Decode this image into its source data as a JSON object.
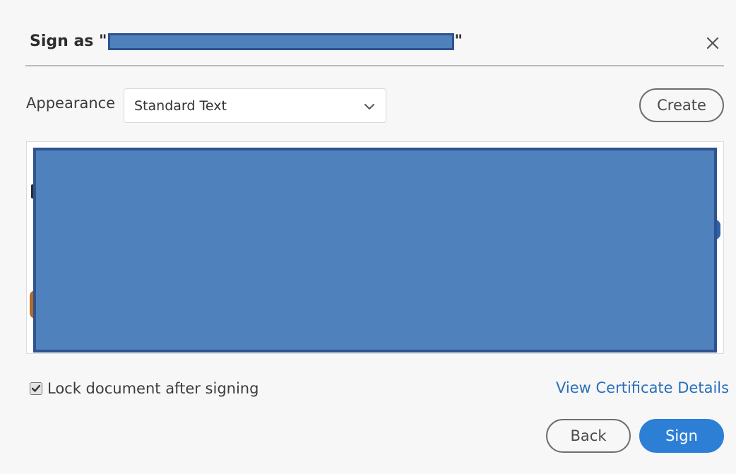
{
  "dialog": {
    "title_prefix": "Sign as \"",
    "title_suffix": "\"",
    "close_icon": "close-icon"
  },
  "appearance": {
    "label": "Appearance",
    "selected": "Standard Text",
    "dropdown_icon": "chevron-down-icon"
  },
  "buttons": {
    "create": "Create",
    "back": "Back",
    "sign": "Sign"
  },
  "options": {
    "lock_label": "Lock document after signing",
    "lock_checked": true
  },
  "links": {
    "view_certificate": "View Certificate Details"
  },
  "colors": {
    "primary": "#2d7fd6",
    "link": "#2a6fbb",
    "redaction": "#4f81bd"
  }
}
